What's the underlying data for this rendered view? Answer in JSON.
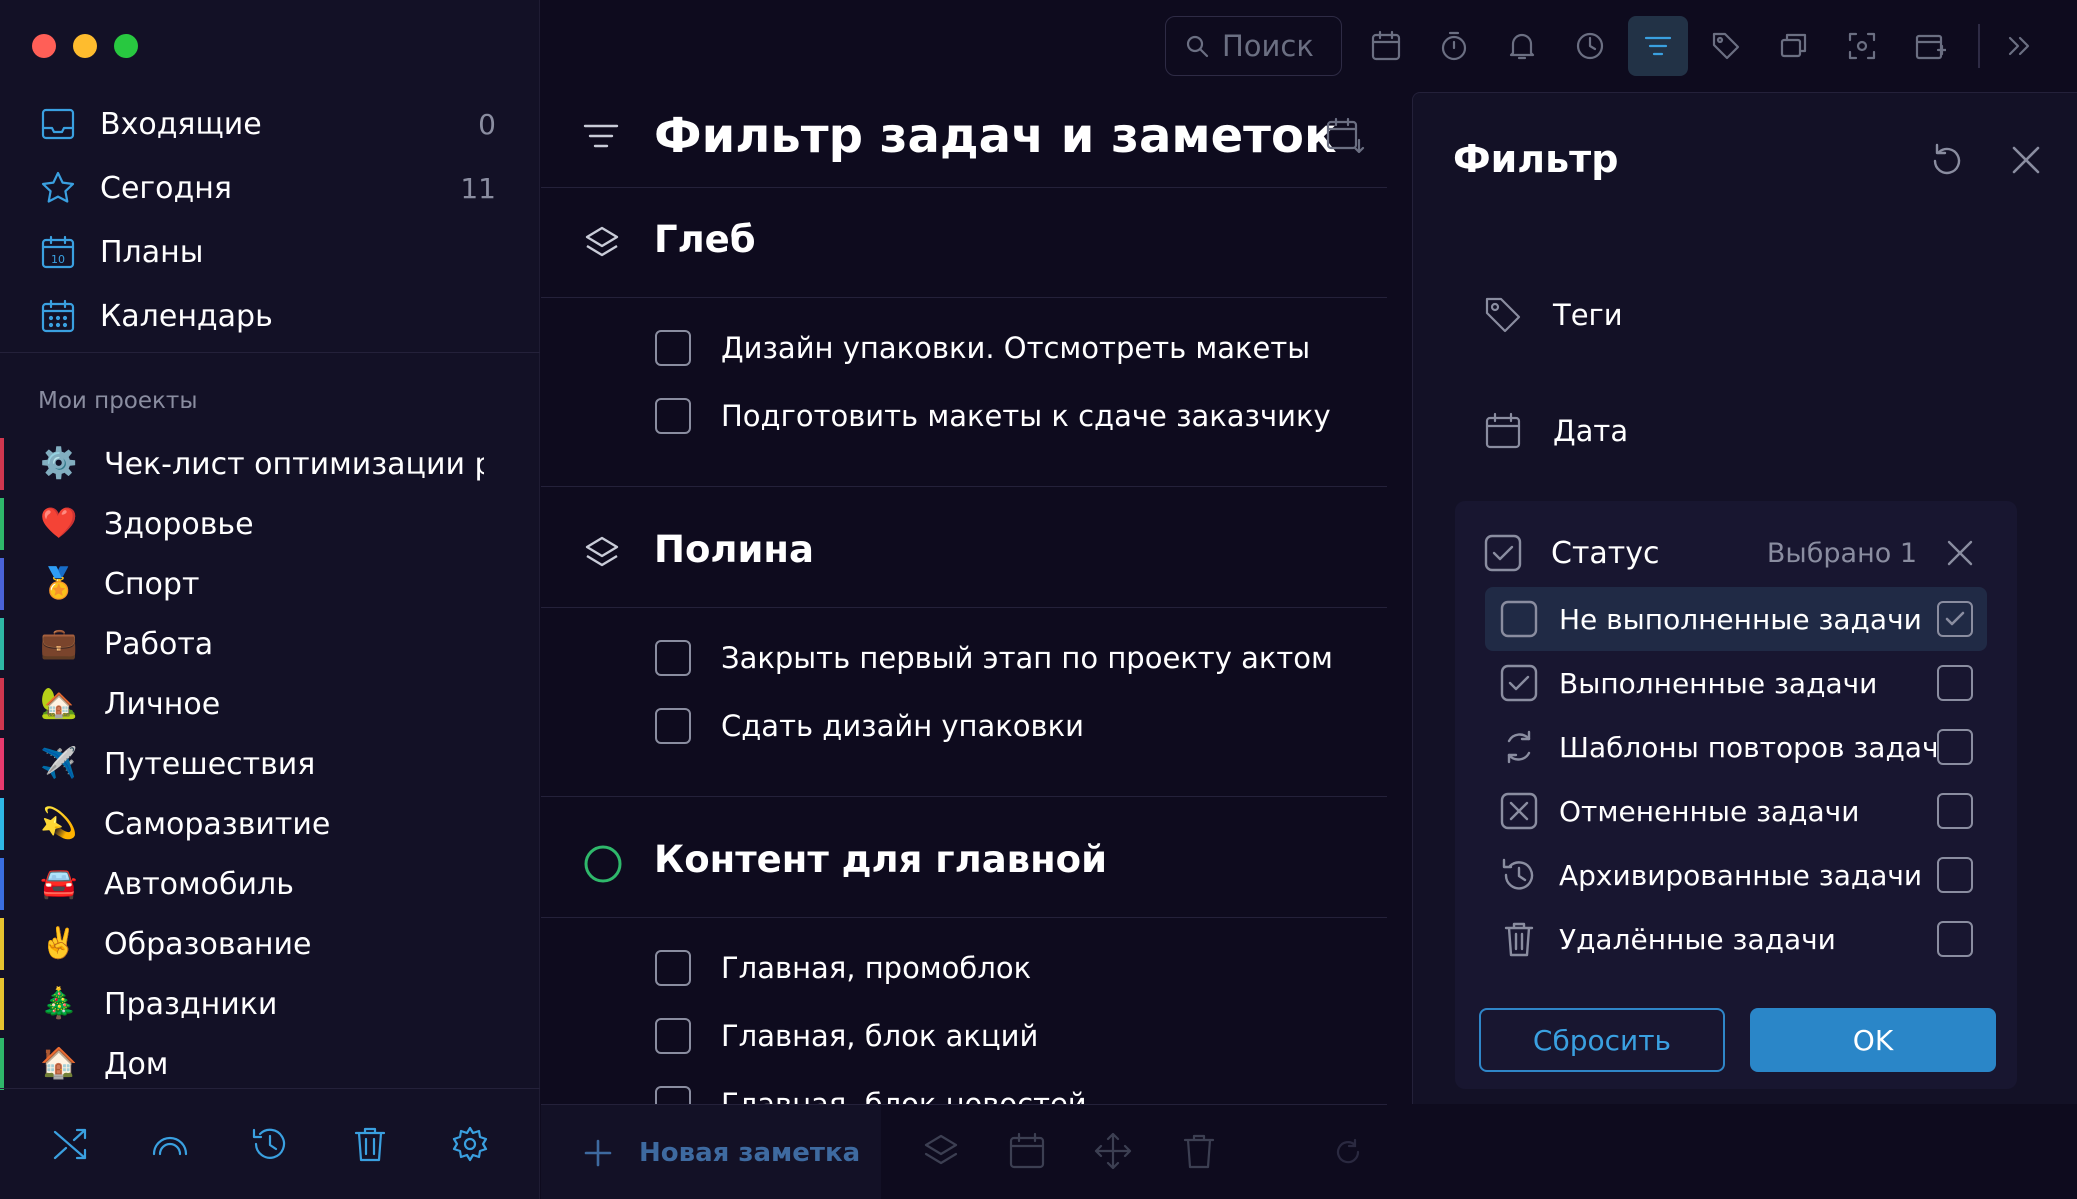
{
  "window": {
    "traffic_colors": [
      "#ff5f57",
      "#febc2e",
      "#28c840"
    ]
  },
  "sidebar": {
    "nav": [
      {
        "label": "Входящие",
        "count": "0",
        "icon": "inbox-icon"
      },
      {
        "label": "Сегодня",
        "count": "11",
        "icon": "star-icon"
      },
      {
        "label": "Планы",
        "count": "",
        "icon": "calendar-10-icon"
      },
      {
        "label": "Календарь",
        "count": "",
        "icon": "calendar-grid-icon"
      }
    ],
    "projects_title": "Мои проекты",
    "projects": [
      {
        "emoji": "⚙️",
        "label": "Чек-лист оптимизации работы",
        "color": "#d0374f"
      },
      {
        "emoji": "❤️",
        "label": "Здоровье",
        "color": "#2fb86b"
      },
      {
        "emoji": "🏅",
        "label": "Спорт",
        "color": "#4a63d8"
      },
      {
        "emoji": "💼",
        "label": "Работа",
        "color": "#2fb8a5"
      },
      {
        "emoji": "🏡",
        "label": "Личное",
        "color": "#d0374f"
      },
      {
        "emoji": "✈️",
        "label": "Путешествия",
        "color": "#e83a6e"
      },
      {
        "emoji": "💫",
        "label": "Саморазвитие",
        "color": "#2fb8e6"
      },
      {
        "emoji": "🚘",
        "label": "Автомобиль",
        "color": "#3a6ee0"
      },
      {
        "emoji": "✌️",
        "label": "Образование",
        "color": "#e6c32f"
      },
      {
        "emoji": "🎄",
        "label": "Праздники",
        "color": "#e6c32f"
      },
      {
        "emoji": "🏠",
        "label": "Дом",
        "color": "#2fb86b"
      }
    ],
    "bottom_icons": [
      "shuffle-icon",
      "rainbow-icon",
      "history-icon",
      "trash-icon",
      "settings-icon"
    ]
  },
  "toolbar": {
    "search_placeholder": "Поиск",
    "icons": [
      "calendar-icon",
      "timer-icon",
      "bell-icon",
      "focus-icon",
      "filter-icon",
      "tag-icon",
      "cards-icon",
      "scan-icon",
      "add-window-icon",
      "chevrons-right-icon"
    ],
    "active": "filter-icon"
  },
  "main": {
    "title": "Фильтр задач и заметок",
    "groups": [
      {
        "title": "Глеб",
        "tasks": [
          "Дизайн упаковки. Отсмотреть макеты",
          "Подготовить макеты к сдаче заказчику"
        ]
      },
      {
        "title": "Полина",
        "tasks": [
          "Закрыть первый этап по проекту актом",
          "Сдать дизайн упаковки"
        ]
      },
      {
        "title": "Контент для главной",
        "tasks": [
          "Главная, промоблок",
          "Главная, блок акций",
          "Главная, блок новостей"
        ]
      }
    ],
    "new_note": "Новая заметка"
  },
  "filter": {
    "title": "Фильтр",
    "tags_label": "Теги",
    "date_label": "Дата",
    "status_label": "Статус",
    "status_count": "Выбрано 1",
    "options": [
      {
        "label": "Не выполненные задачи",
        "icon": "checkbox-empty-icon",
        "checked": true
      },
      {
        "label": "Выполненные задачи",
        "icon": "checkbox-checked-icon",
        "checked": false
      },
      {
        "label": "Шаблоны повторов задач",
        "icon": "repeat-icon",
        "checked": false
      },
      {
        "label": "Отмененные задачи",
        "icon": "cancelled-icon",
        "checked": false
      },
      {
        "label": "Архивированные задачи",
        "icon": "archive-icon",
        "checked": false
      },
      {
        "label": "Удалённые задачи",
        "icon": "trash-icon",
        "checked": false
      }
    ],
    "reset_label": "Сбросить",
    "ok_label": "OK"
  }
}
